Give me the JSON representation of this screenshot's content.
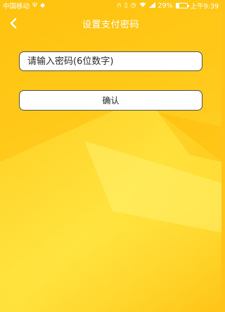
{
  "status_bar": {
    "carrier": "中国移动",
    "battery_percent": "29%",
    "battery_level": 0.29,
    "time": "上午9:39"
  },
  "nav": {
    "title": "设置支付密码"
  },
  "form": {
    "password_placeholder": "请输入密码(6位数字)",
    "password_value": "",
    "confirm_label": "确认"
  },
  "colors": {
    "background": "#ffc31a",
    "text_white": "#ffffff",
    "field_border": "#505050"
  }
}
